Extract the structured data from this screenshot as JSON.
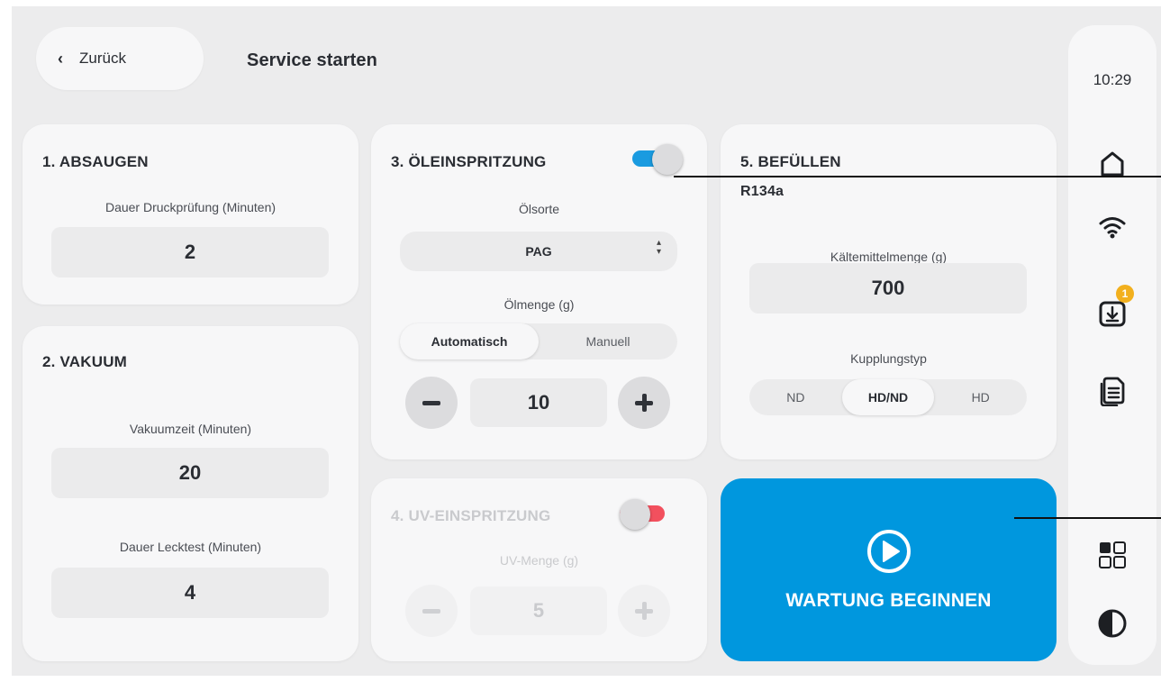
{
  "header": {
    "back_label": "Zurück",
    "title": "Service starten"
  },
  "absaugen": {
    "title": "1. ABSAUGEN",
    "label": "Dauer Druckprüfung (Minuten)",
    "value": "2"
  },
  "vakuum": {
    "title": "2. VAKUUM",
    "time_label": "Vakuumzeit (Minuten)",
    "time_value": "20",
    "leak_label": "Dauer Lecktest (Minuten)",
    "leak_value": "4"
  },
  "oel": {
    "title": "3. ÖLEINSPRITZUNG",
    "enabled": true,
    "type_label": "Ölsorte",
    "type_value": "PAG",
    "amount_label": "Ölmenge (g)",
    "mode_options": [
      "Automatisch",
      "Manuell"
    ],
    "mode_selected": "Automatisch",
    "amount_value": "10"
  },
  "uv": {
    "title": "4. UV-EINSPRITZUNG",
    "enabled": false,
    "amount_label": "UV-Menge (g)",
    "amount_value": "5"
  },
  "befuellen": {
    "title": "5. BEFÜLLEN",
    "refrigerant": "R134a",
    "amount_label": "Kältemittelmenge (g)",
    "amount_value": "700",
    "coupling_label": "Kupplungstyp",
    "coupling_options": [
      "ND",
      "HD/ND",
      "HD"
    ],
    "coupling_selected": "HD/ND"
  },
  "start": {
    "label": "WARTUNG BEGINNEN"
  },
  "sidebar": {
    "time": "10:29",
    "downloads_badge": "1",
    "icons": [
      "home-icon",
      "wifi-icon",
      "download-icon",
      "documents-icon",
      "apps-grid-icon",
      "contrast-icon"
    ]
  },
  "colors": {
    "accent": "#0097de",
    "toggle_on": "#1a9be0",
    "toggle_off": "#f2505e",
    "badge": "#f2b01e"
  }
}
